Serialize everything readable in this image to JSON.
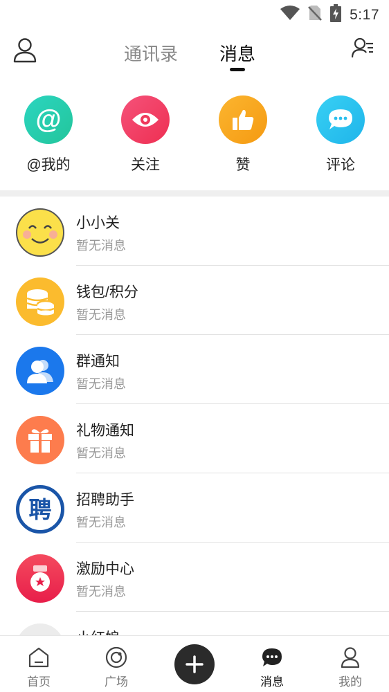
{
  "status_bar": {
    "time": "5:17",
    "icons": [
      "wifi-icon",
      "no-sim-icon",
      "battery-charging-icon"
    ]
  },
  "header": {
    "left_icon": "user-icon",
    "right_icon": "contacts-list-icon",
    "tabs": [
      {
        "label": "通讯录",
        "active": false
      },
      {
        "label": "消息",
        "active": true
      }
    ]
  },
  "quick_actions": [
    {
      "label": "@我的",
      "icon": "at-icon",
      "color": "#2fd3b1"
    },
    {
      "label": "关注",
      "icon": "eye-icon",
      "color": "#f13d63"
    },
    {
      "label": "赞",
      "icon": "thumbs-up-icon",
      "color": "#f8a81e"
    },
    {
      "label": "评论",
      "icon": "comment-icon",
      "color": "#2fc6f0"
    }
  ],
  "messages": [
    {
      "title": "小小关",
      "subtitle": "暂无消息",
      "icon": "smiley-icon"
    },
    {
      "title": "钱包/积分",
      "subtitle": "暂无消息",
      "icon": "coins-icon"
    },
    {
      "title": "群通知",
      "subtitle": "暂无消息",
      "icon": "group-icon"
    },
    {
      "title": "礼物通知",
      "subtitle": "暂无消息",
      "icon": "gift-icon"
    },
    {
      "title": "招聘助手",
      "subtitle": "暂无消息",
      "icon": "recruit-icon",
      "badge_text": "聘"
    },
    {
      "title": "激励中心",
      "subtitle": "暂无消息",
      "icon": "medal-icon"
    },
    {
      "title": "小红娘",
      "subtitle": "",
      "icon": "matchmaker-icon"
    }
  ],
  "bottom_nav": [
    {
      "label": "首页",
      "icon": "home-icon",
      "active": false
    },
    {
      "label": "广场",
      "icon": "plaza-icon",
      "active": false
    },
    {
      "label": "",
      "icon": "plus-icon",
      "active": false
    },
    {
      "label": "消息",
      "icon": "message-icon",
      "active": true
    },
    {
      "label": "我的",
      "icon": "profile-icon",
      "active": false
    }
  ]
}
